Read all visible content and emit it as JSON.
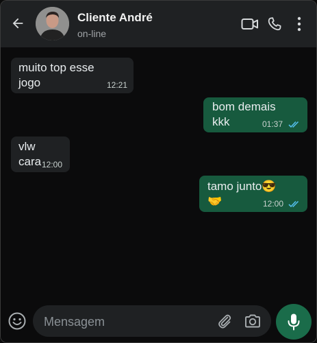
{
  "header": {
    "contact_name": "Cliente André",
    "status": "on-line",
    "icons": [
      "back-arrow-icon",
      "video-call-icon",
      "phone-icon",
      "more-vert-icon"
    ]
  },
  "messages": [
    {
      "direction": "incoming",
      "text": "muito top esse\njogo",
      "time": "12:21"
    },
    {
      "direction": "outgoing",
      "text": "bom demais\nkkk",
      "time": "01:37",
      "read": true
    },
    {
      "direction": "incoming",
      "text": "vlw\ncara",
      "time": "12:00"
    },
    {
      "direction": "outgoing",
      "text": "tamo junto😎\n🤝",
      "time": "12:00",
      "read": true
    }
  ],
  "composer": {
    "placeholder": "Mensagem",
    "icons": [
      "emoji-icon",
      "paperclip-icon",
      "camera-icon",
      "microphone-icon"
    ]
  },
  "colors": {
    "header_bg": "#1f2123",
    "incoming_bubble": "#1f2123",
    "outgoing_bubble": "#175a3e",
    "read_ticks": "#53bdeb",
    "mic_button": "#1a6c4a"
  }
}
